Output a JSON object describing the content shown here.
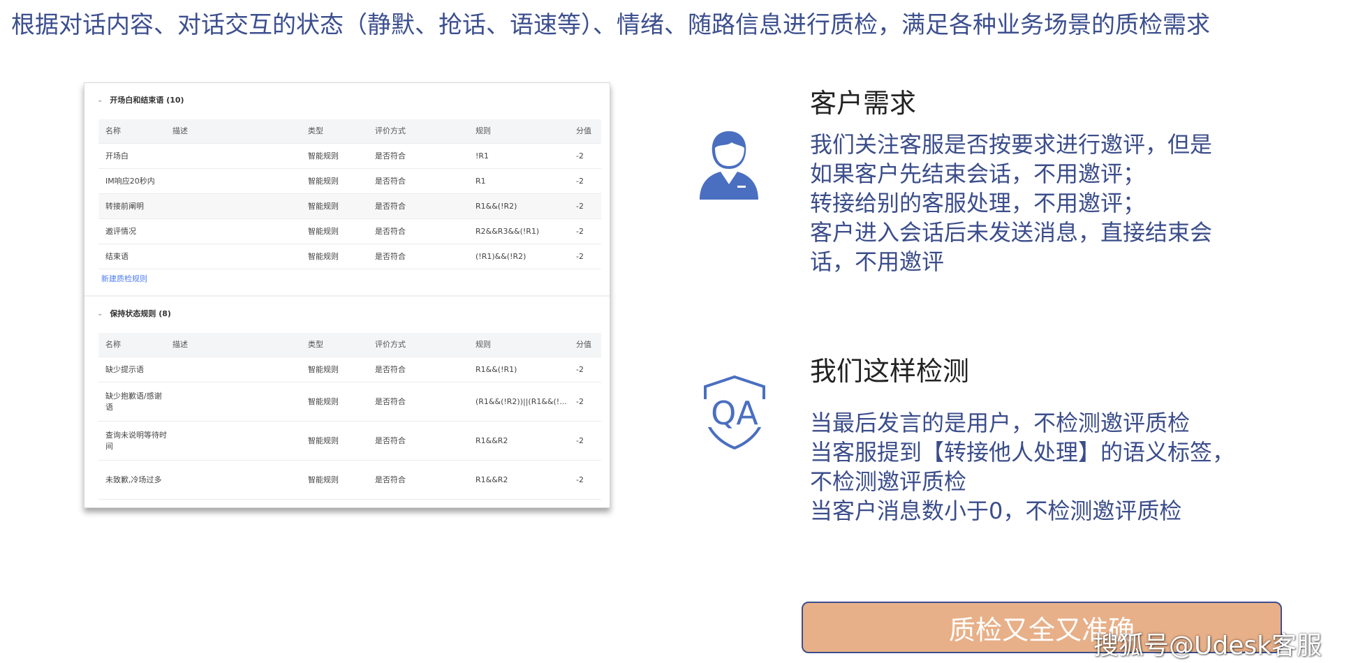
{
  "headline": "根据对话内容、对话交互的状态（静默、抢话、语速等）、情绪、随路信息进行质检，满足各种业务场景的质检需求",
  "panel": {
    "section1": {
      "title": "开场白和结束语 (10)",
      "headers": [
        "名称",
        "描述",
        "类型",
        "评价方式",
        "规则",
        "分值"
      ],
      "rows": [
        {
          "name": "开场白",
          "desc": "",
          "type": "智能规则",
          "eval": "是否符合",
          "rule": "!R1",
          "score": "-2"
        },
        {
          "name": "IM响应20秒内",
          "desc": "",
          "type": "智能规则",
          "eval": "是否符合",
          "rule": "R1",
          "score": "-2"
        },
        {
          "name": "转接前阐明",
          "desc": "",
          "type": "智能规则",
          "eval": "是否符合",
          "rule": "R1&&(!R2)",
          "score": "-2"
        },
        {
          "name": "邀评情况",
          "desc": "",
          "type": "智能规则",
          "eval": "是否符合",
          "rule": "R2&&R3&&(!R1)",
          "score": "-2"
        },
        {
          "name": "结束语",
          "desc": "",
          "type": "智能规则",
          "eval": "是否符合",
          "rule": "(!R1)&&(!R2)",
          "score": "-2"
        }
      ],
      "new_rule": "新建质检规则"
    },
    "section2": {
      "title": "保持状态规则 (8)",
      "headers": [
        "名称",
        "描述",
        "类型",
        "评价方式",
        "规则",
        "分值"
      ],
      "rows": [
        {
          "name": "缺少提示语",
          "desc": "",
          "type": "智能规则",
          "eval": "是否符合",
          "rule": "R1&&(!R1)",
          "score": "-2"
        },
        {
          "name": "缺少抱歉语/感谢语",
          "desc": "",
          "type": "智能规则",
          "eval": "是否符合",
          "rule": "(R1&&(!R2))||(R1&&(!...",
          "score": "-2"
        },
        {
          "name": "查询未说明等待时间",
          "desc": "",
          "type": "智能规则",
          "eval": "是否符合",
          "rule": "R1&&R2",
          "score": "-2"
        },
        {
          "name": "未致歉,冷场过多",
          "desc": "",
          "type": "智能规则",
          "eval": "是否符合",
          "rule": "R1&&R2",
          "score": "-2"
        }
      ]
    }
  },
  "customer": {
    "icon": "customer-service-agent-icon",
    "title": "客户需求",
    "lines": [
      "我们关注客服是否按要求进行邀评，但是",
      "如果客户先结束会话，不用邀评；",
      "转接给别的客服处理，不用邀评；",
      "客户进入会话后未发送消息，直接结束会",
      "话，不用邀评"
    ]
  },
  "detection": {
    "icon": "qa-shield-icon",
    "icon_text": "QA",
    "title": "我们这样检测",
    "lines": [
      "当最后发言的是用户，不检测邀评质检",
      "当客服提到【转接他人处理】的语义标签，",
      "不检测邀评质检",
      "当客户消息数小于0，不检测邀评质检"
    ]
  },
  "cta": {
    "label": "质检又全又准确"
  },
  "watermark": "搜狐号@Udesk客服",
  "colors": {
    "text_blue": "#3b4d8a",
    "icon_blue": "#4a6fc0",
    "cta_fill": "#e8b088",
    "cta_border": "#3c4f8f",
    "link_blue": "#4d7cf5"
  }
}
